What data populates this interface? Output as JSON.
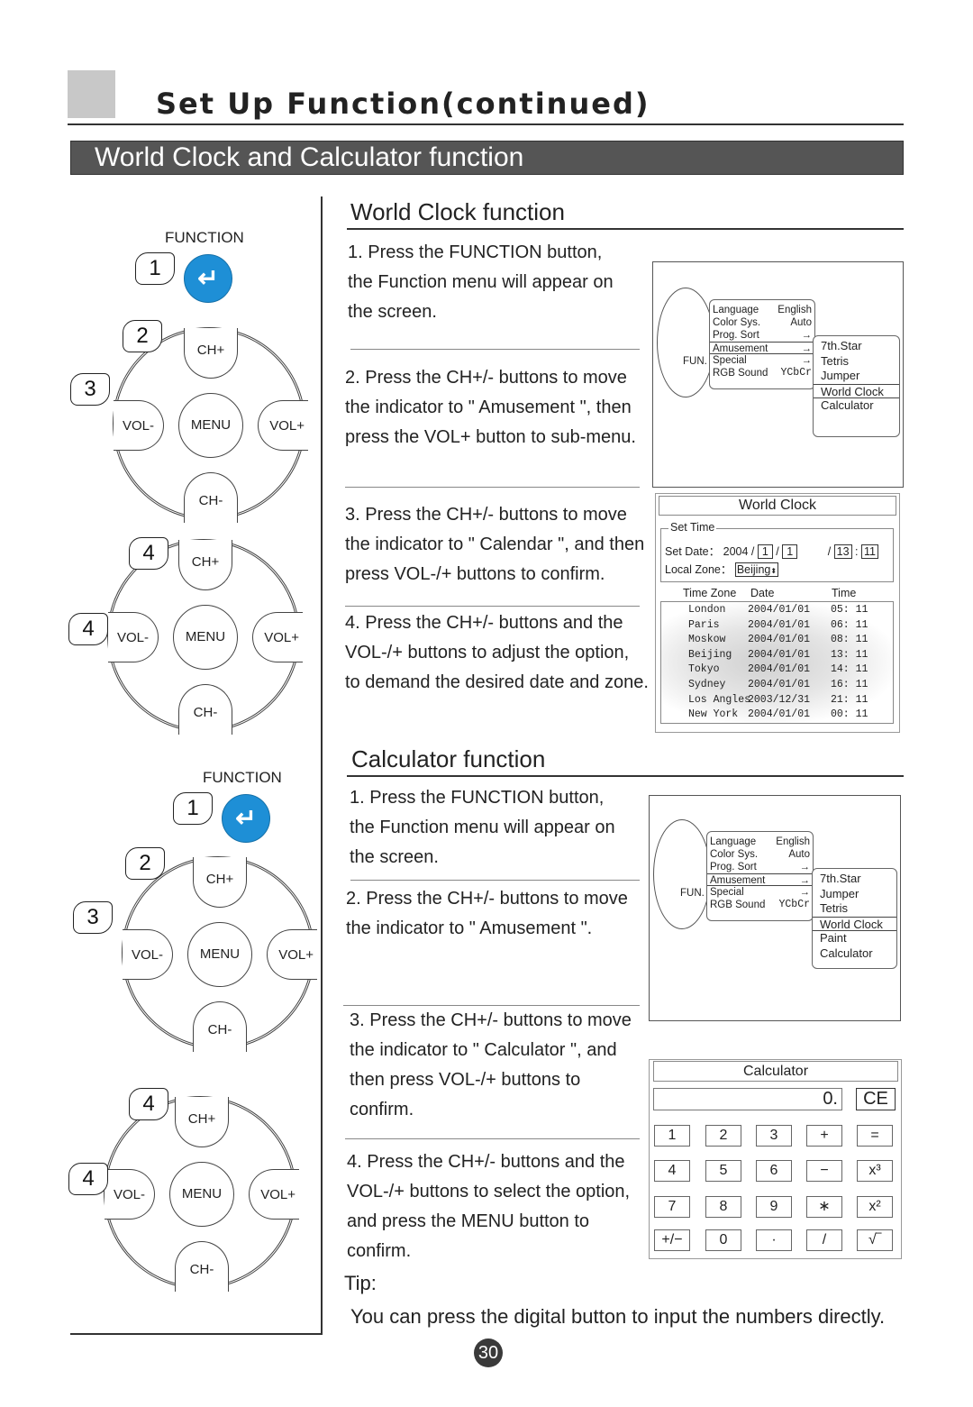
{
  "header": {
    "title": "Set Up Function(continued)",
    "banner": "World Clock and Calculator function"
  },
  "remote": {
    "function_label": "FUNCTION",
    "enter_icon": "enter-return-icon",
    "function_color": "#1e8fd6",
    "keys": {
      "ch_plus": "CH+",
      "ch_minus": "CH-",
      "vol_minus": "VOL-",
      "vol_plus": "VOL+",
      "menu": "MENU"
    }
  },
  "diagrams": [
    {
      "function_step": "1",
      "pad_steps": [
        "2",
        "3"
      ]
    },
    {
      "pad_steps": [
        "4",
        "4"
      ]
    },
    {
      "function_step": "1",
      "pad_steps": [
        "2",
        "3"
      ]
    },
    {
      "pad_steps": [
        "4",
        "4"
      ]
    }
  ],
  "world_clock": {
    "title": "World Clock function",
    "steps": [
      [
        "1. Press the FUNCTION button,",
        "the Function menu will appear on",
        "the screen."
      ],
      [
        "2. Press the CH+/- buttons to move",
        "the indicator to \" Amusement \", then",
        "press the VOL+ button to sub-menu."
      ],
      [
        "3. Press the CH+/- buttons to move",
        "the indicator to \" Calendar \", and then",
        "press VOL-/+ buttons to confirm."
      ],
      [
        "4. Press the CH+/- buttons and the",
        " VOL-/+ buttons to adjust the option,",
        "to demand the desired date and zone."
      ]
    ],
    "osd_menu": {
      "fun_label": "FUN.",
      "items": [
        [
          "Language",
          "English"
        ],
        [
          "Color Sys.",
          "Auto"
        ],
        [
          "Prog. Sort",
          "→"
        ],
        [
          "Amusement",
          "→"
        ],
        [
          "Special",
          "→"
        ],
        [
          "RGB Sound",
          "YCbCr"
        ]
      ],
      "selected": "Amusement",
      "sub_items": [
        "7th.Star",
        "Tetris",
        "Jumper",
        "World Clock",
        "Calculator"
      ],
      "sub_selected": "World Clock"
    },
    "dialog": {
      "title": "World Clock",
      "set_time_label": "Set Time",
      "set_date_label": "Set Date：",
      "year": "2004 /",
      "month": "1",
      "day": "1",
      "hour": "13",
      "minute": "11",
      "local_zone_label": "Local Zone：",
      "local_zone": "Beijing",
      "columns": [
        "Time Zone",
        "Date",
        "Time"
      ],
      "rows": [
        [
          "London",
          "2004/01/01",
          "05: 11"
        ],
        [
          "Paris",
          "2004/01/01",
          "06: 11"
        ],
        [
          "Moskow",
          "2004/01/01",
          "08: 11"
        ],
        [
          "Beijing",
          "2004/01/01",
          "13: 11"
        ],
        [
          "Tokyo",
          "2004/01/01",
          "14: 11"
        ],
        [
          "Sydney",
          "2004/01/01",
          "16: 11"
        ],
        [
          "Los Angles",
          "2003/12/31",
          "21: 11"
        ],
        [
          "New York",
          "2004/01/01",
          "00: 11"
        ]
      ]
    }
  },
  "calculator": {
    "title": "Calculator function",
    "steps": [
      [
        "1. Press the FUNCTION button,",
        "the Function menu will appear on",
        "the screen."
      ],
      [
        "2. Press the CH+/- buttons to move",
        "the indicator to \" Amusement \"."
      ],
      [
        "3. Press the CH+/- buttons to move",
        "the indicator to \" Calculator \", and",
        "then  press VOL-/+ buttons to",
        "confirm."
      ],
      [
        "4. Press the CH+/- buttons and the",
        "VOL-/+ buttons to select the option,",
        "and press the MENU button to",
        "confirm."
      ]
    ],
    "osd_menu": {
      "fun_label": "FUN.",
      "items": [
        [
          "Language",
          "English"
        ],
        [
          "Color Sys.",
          "Auto"
        ],
        [
          "Prog. Sort",
          "→"
        ],
        [
          "Amusement",
          "→"
        ],
        [
          "Special",
          "→"
        ],
        [
          "RGB Sound",
          "YCbCr"
        ]
      ],
      "selected": "Amusement",
      "sub_items": [
        "7th.Star",
        "Jumper",
        "Tetris",
        "World Clock",
        "Paint",
        "Calculator"
      ],
      "sub_selected": "World Clock"
    },
    "dialog": {
      "title": "Calculator",
      "display": "0.",
      "clear": "CE",
      "keys": [
        [
          "1",
          "2",
          "3",
          "+",
          "="
        ],
        [
          "4",
          "5",
          "6",
          "−",
          "x³"
        ],
        [
          "7",
          "8",
          "9",
          "∗",
          "x²"
        ],
        [
          "+/−",
          "0",
          "·",
          "/",
          "√‾"
        ]
      ]
    }
  },
  "tip": {
    "label": "Tip:",
    "text": "You can press the digital button to input the numbers directly."
  },
  "page_number": "30"
}
